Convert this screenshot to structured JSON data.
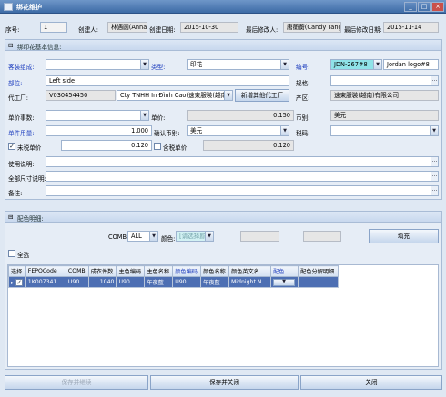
{
  "window": {
    "title": "绑花维护",
    "controls": [
      "_",
      "□",
      "×"
    ]
  },
  "header_row": {
    "seq_label": "序号:",
    "seq_value": "1",
    "creator_label": "创建人:",
    "creator_value": "林遇圆(Annabel",
    "created_label": "创建日期:",
    "created_value": "2015-10-30",
    "modifier_label": "最后修改人:",
    "modifier_value": "唐蘅蘅(Candy Tang)",
    "modified_label": "最后修改日期:",
    "modified_value": "2015-11-14"
  },
  "basic_group": {
    "title": "绑印花基本信息:",
    "style_label": "客装组成:",
    "style_value": "",
    "type_label": "类型:",
    "type_value": "印花",
    "code_label": "编号:",
    "code_value": "JDN-267#8",
    "code_name": "Jordan logo#8",
    "part_label": "部位:",
    "part_value": "Left side",
    "spec_label": "规格:",
    "spec_value": "",
    "factory_label": "代工厂:",
    "factory_code": "V030454450",
    "factory_name": "Cty TNHH In Đình Cao(速東服裝(越南)有限公",
    "add_factory_button": "新增其他代工厂",
    "origin_label": "产区:",
    "origin_value": "速東服裝(越南)有限公司",
    "price_factor_label": "单价事数:",
    "price_factor_value": "",
    "unit_price_label": "单价:",
    "unit_price_value": "0.150",
    "currency_label": "币别:",
    "currency_value": "美元",
    "unit_usage_label": "单件用量:",
    "unit_usage_value": "1.000",
    "confirm_currency_label": "确认币别:",
    "confirm_currency_value": "美元",
    "tax_label": "税码:",
    "tax_value": "",
    "untaxed_label": "未税单价",
    "untaxed_value": "0.120",
    "taxed_label": "含税单价",
    "taxed_value": "0.120",
    "usage_desc_label": "使用说明:",
    "usage_desc_value": "",
    "all_size_label": "全部尺寸说明:",
    "all_size_value": "",
    "remark_label": "备注:",
    "remark_value": ""
  },
  "color_group": {
    "title": "配色明细:",
    "comb_label": "COMB:",
    "comb_value": "ALL",
    "color_label": "颜色:",
    "color_placeholder": "[请选择颜色]",
    "fill_button": "填充",
    "select_all_label": "全选",
    "columns": [
      "选择",
      "FEPOCode",
      "COMB",
      "成衣件数",
      "主色编码",
      "主色名称",
      "颜色编码",
      "颜色名称",
      "颜色英文名...",
      "配色...",
      "配色分解明细"
    ],
    "rows": [
      {
        "checked": "✓",
        "fepo": "1K007341...",
        "comb": "U90",
        "qty": "1040",
        "main_code": "U90",
        "main_name": "午夜藍",
        "color_code": "U90",
        "color_name": "午夜藍",
        "color_en": "Midnight N...",
        "match": "",
        "detail": ""
      }
    ]
  },
  "footer": {
    "save_continue": "保存并继续",
    "save_close": "保存并关闭",
    "close": "关闭"
  },
  "colors": {
    "titlebar": "#3d6ba6",
    "selected_row": "#4d6fb3",
    "highlight_code": "#8fe3e8"
  }
}
